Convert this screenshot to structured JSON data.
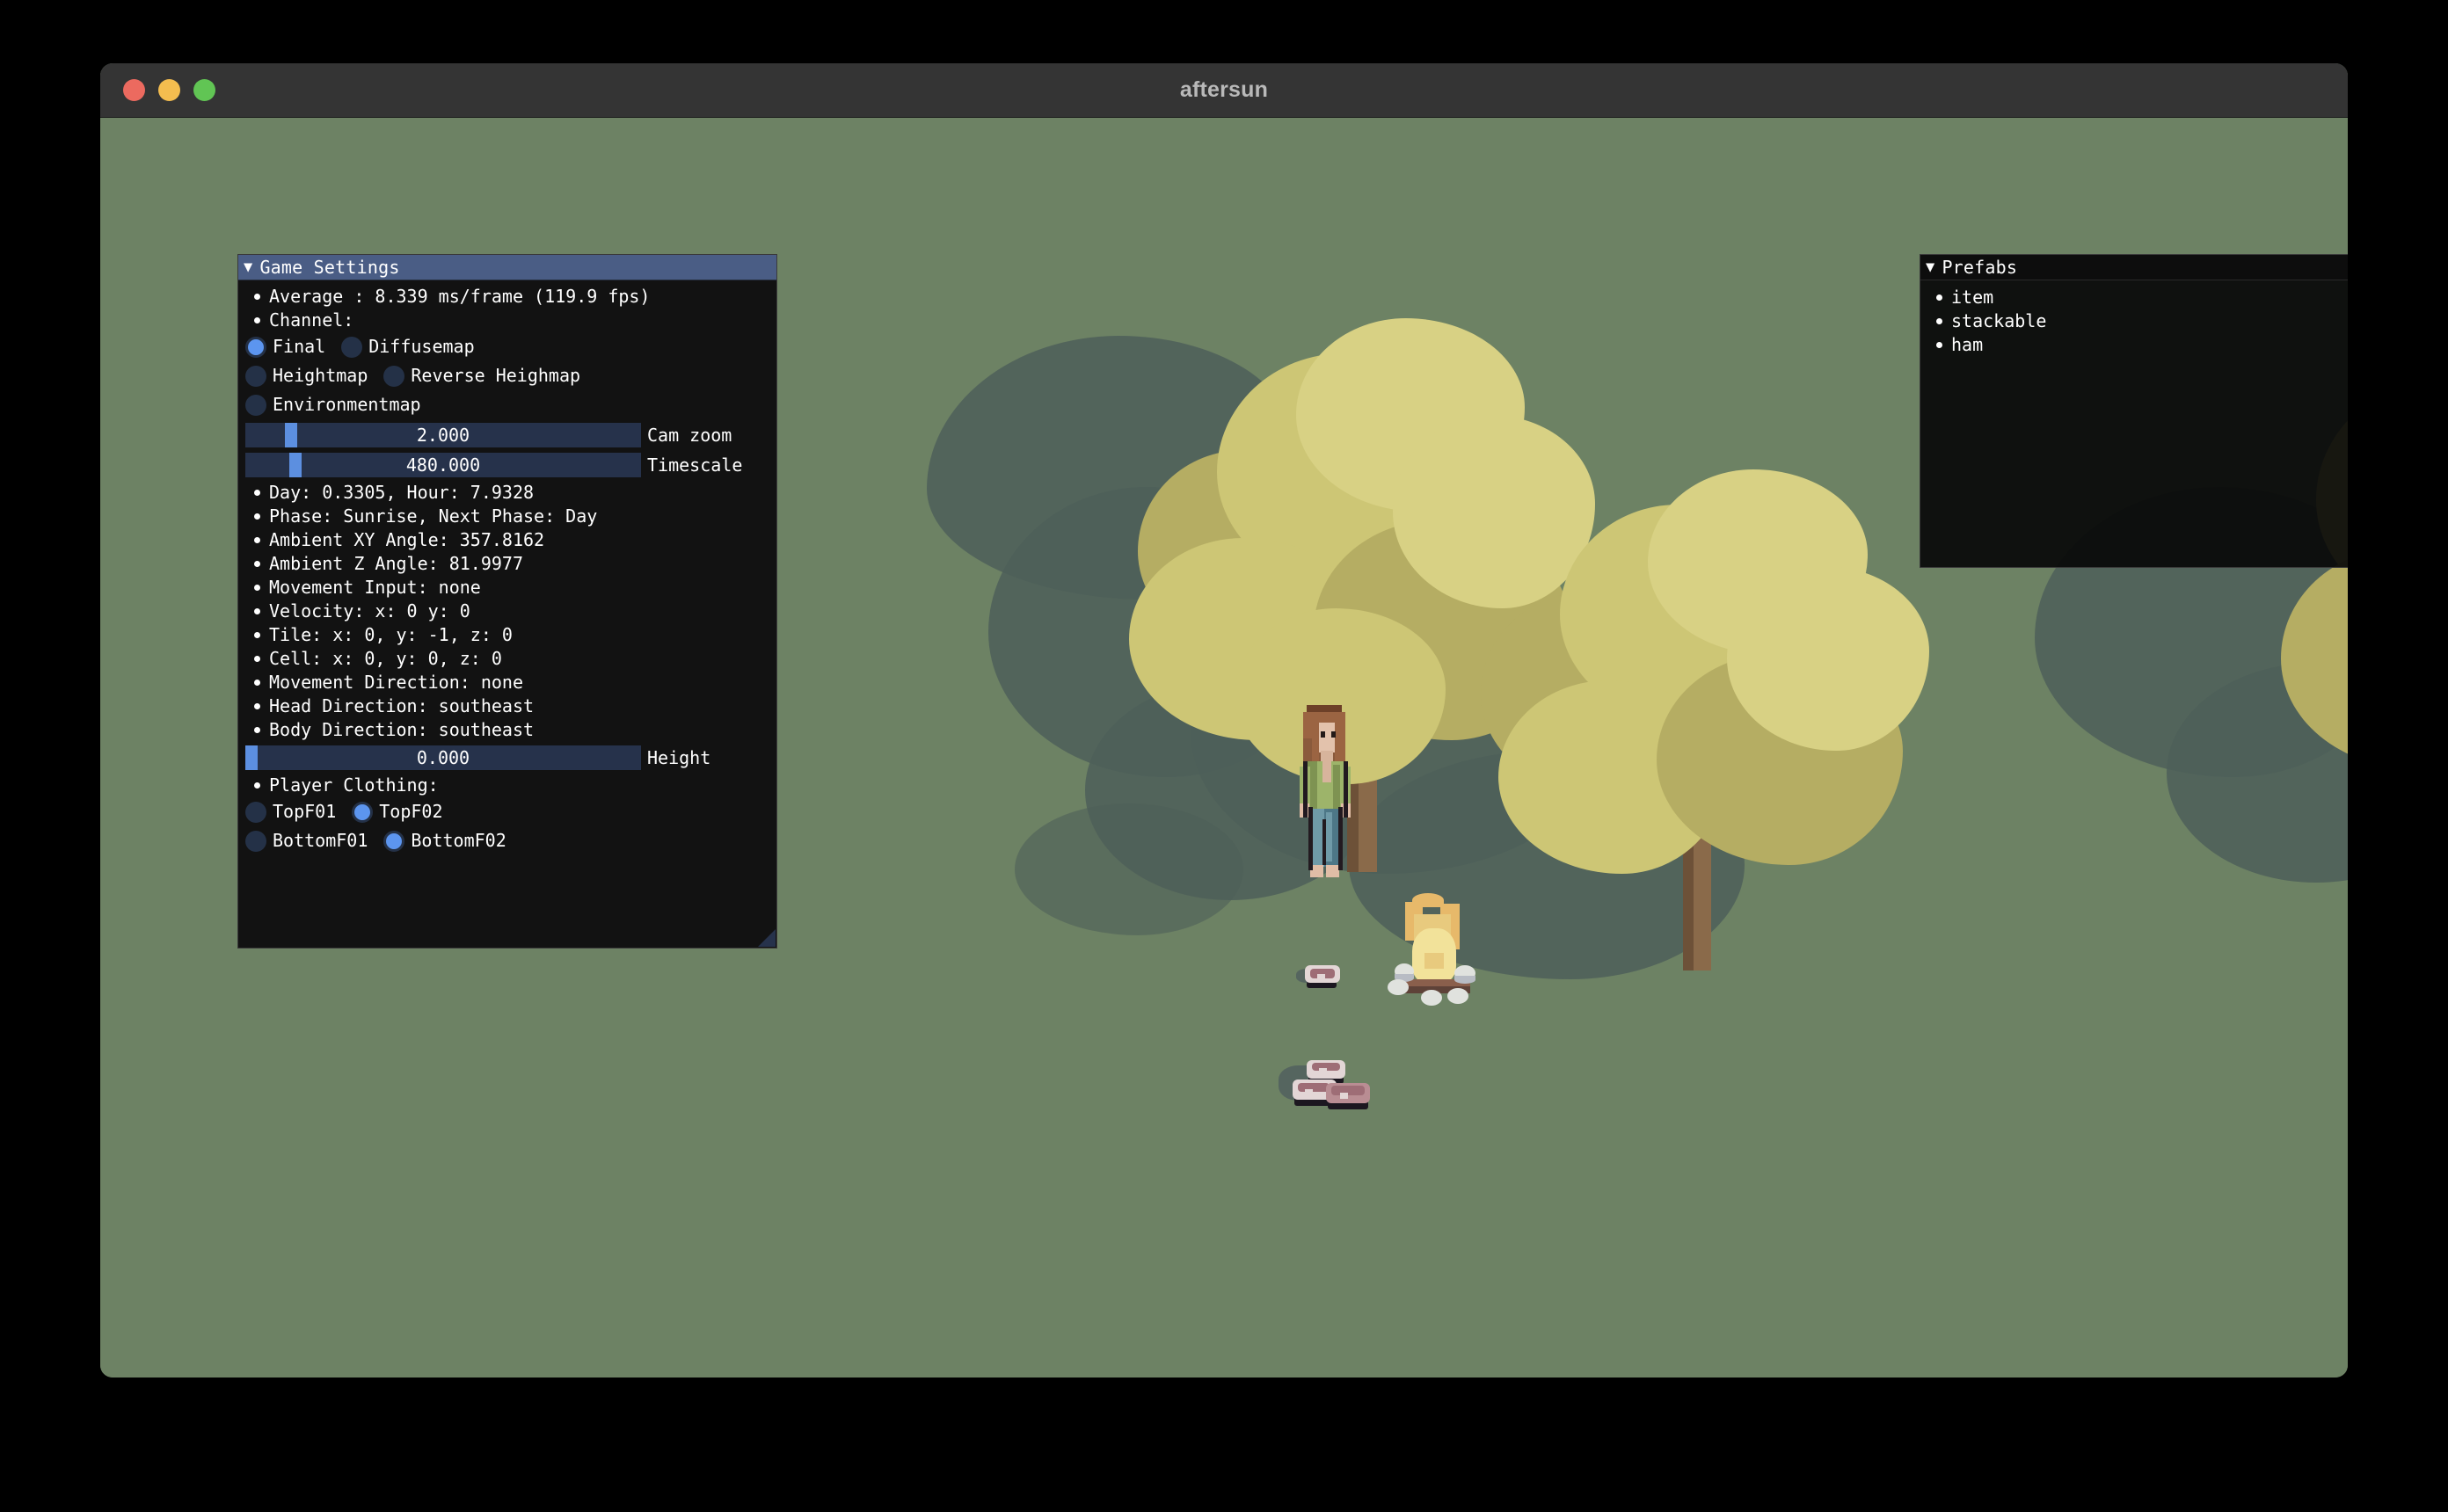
{
  "window": {
    "title": "aftersun",
    "traffic_lights": [
      {
        "name": "close",
        "color": "#ec6a5f"
      },
      {
        "name": "minimize",
        "color": "#f4bd4f"
      },
      {
        "name": "zoom",
        "color": "#61c554"
      }
    ],
    "titlebar_color": "#343434"
  },
  "scene": {
    "ground_color": "#6d8264",
    "shadow_color": "#4e5f59",
    "foliage_color": "#cdc675",
    "trunk_color": "#8a6a4a"
  },
  "game_settings": {
    "caret": "▼",
    "title": "Game Settings",
    "average": "Average :  8.339 ms/frame (119.9 fps)",
    "channel_label": "Channel:",
    "channel_options": [
      {
        "label": "Final",
        "selected": true
      },
      {
        "label": "Diffusemap",
        "selected": false
      },
      {
        "label": "Heightmap",
        "selected": false
      },
      {
        "label": "Reverse Heighmap",
        "selected": false
      },
      {
        "label": "Environmentmap",
        "selected": false
      }
    ],
    "sliders": [
      {
        "label": "Cam zoom",
        "value": "2.000",
        "fill_pct": 10
      },
      {
        "label": "Timescale",
        "value": "480.000",
        "fill_pct": 11
      }
    ],
    "stats": [
      "Day: 0.3305, Hour: 7.9328",
      "Phase: Sunrise, Next Phase: Day",
      "Ambient XY Angle: 357.8162",
      "Ambient Z Angle: 81.9977",
      "Movement Input: none",
      "Velocity: x: 0 y: 0",
      "Tile: x: 0, y: -1, z: 0",
      "Cell: x: 0, y: 0, z: 0",
      "Movement Direction: none",
      "Head Direction: southeast",
      "Body Direction: southeast"
    ],
    "height_slider": {
      "label": "Height",
      "value": "0.000",
      "fill_pct": 0
    },
    "clothing_label": "Player Clothing:",
    "clothing_options": [
      {
        "label": "TopF01",
        "selected": false
      },
      {
        "label": "TopF02",
        "selected": true
      },
      {
        "label": "BottomF01",
        "selected": false
      },
      {
        "label": "BottomF02",
        "selected": true
      }
    ],
    "accent_color": "#5c95ef",
    "header_color": "#4a5d85"
  },
  "prefabs": {
    "caret": "▼",
    "title": "Prefabs",
    "items": [
      "item",
      "stackable",
      "ham"
    ]
  }
}
